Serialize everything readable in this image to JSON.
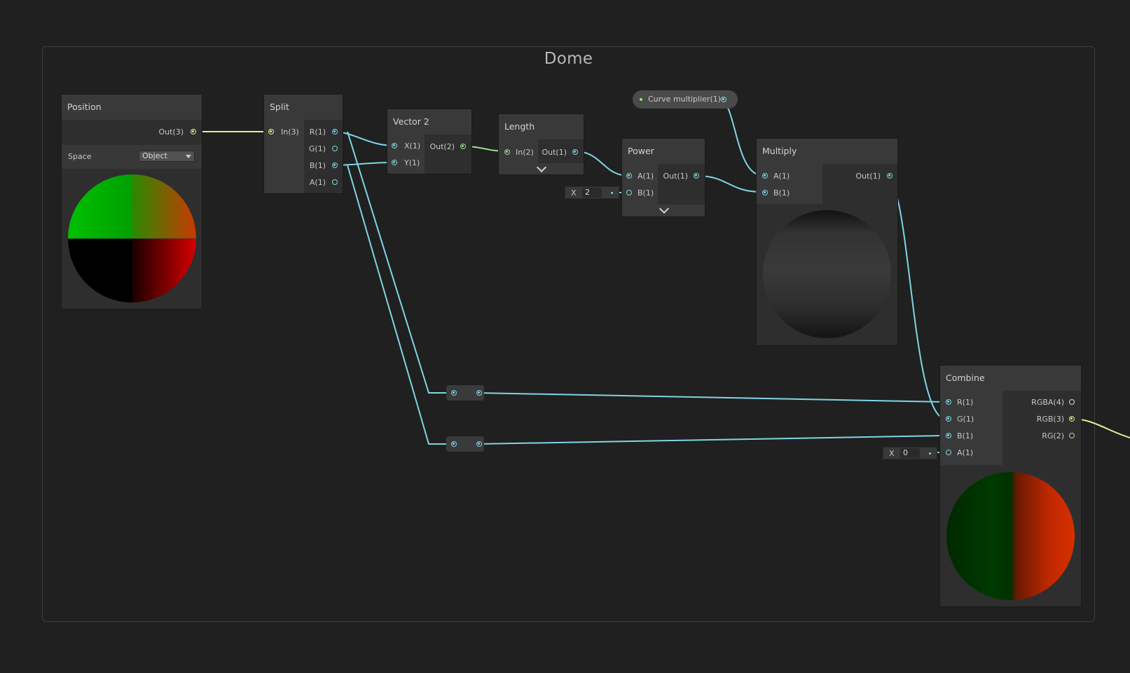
{
  "group": {
    "title": "Dome"
  },
  "nodes": {
    "position": {
      "title": "Position",
      "out": "Out(3)",
      "space_label": "Space",
      "space_value": "Object"
    },
    "split": {
      "title": "Split",
      "in": "In(3)",
      "outs": [
        "R(1)",
        "G(1)",
        "B(1)",
        "A(1)"
      ]
    },
    "vector2": {
      "title": "Vector 2",
      "ins": [
        "X(1)",
        "Y(1)"
      ],
      "out": "Out(2)"
    },
    "length": {
      "title": "Length",
      "in": "In(2)",
      "out": "Out(1)"
    },
    "power": {
      "title": "Power",
      "ins": [
        "A(1)",
        "B(1)"
      ],
      "out": "Out(1)",
      "b_field": {
        "axis": "X",
        "value": "2"
      }
    },
    "property": {
      "label": "Curve multiplier(1)"
    },
    "multiply": {
      "title": "Multiply",
      "ins": [
        "A(1)",
        "B(1)"
      ],
      "out": "Out(1)"
    },
    "combine": {
      "title": "Combine",
      "ins": [
        "R(1)",
        "G(1)",
        "B(1)",
        "A(1)"
      ],
      "outs": [
        "RGBA(4)",
        "RGB(3)",
        "RG(2)"
      ],
      "a_field": {
        "axis": "X",
        "value": "0"
      }
    }
  },
  "colors": {
    "background": "#202020",
    "node_body": "#2e2e2e",
    "node_header": "#393939",
    "wire_float": "#7fd6e3",
    "wire_vector3": "#ebeb96",
    "wire_vector2": "#9de08a"
  }
}
